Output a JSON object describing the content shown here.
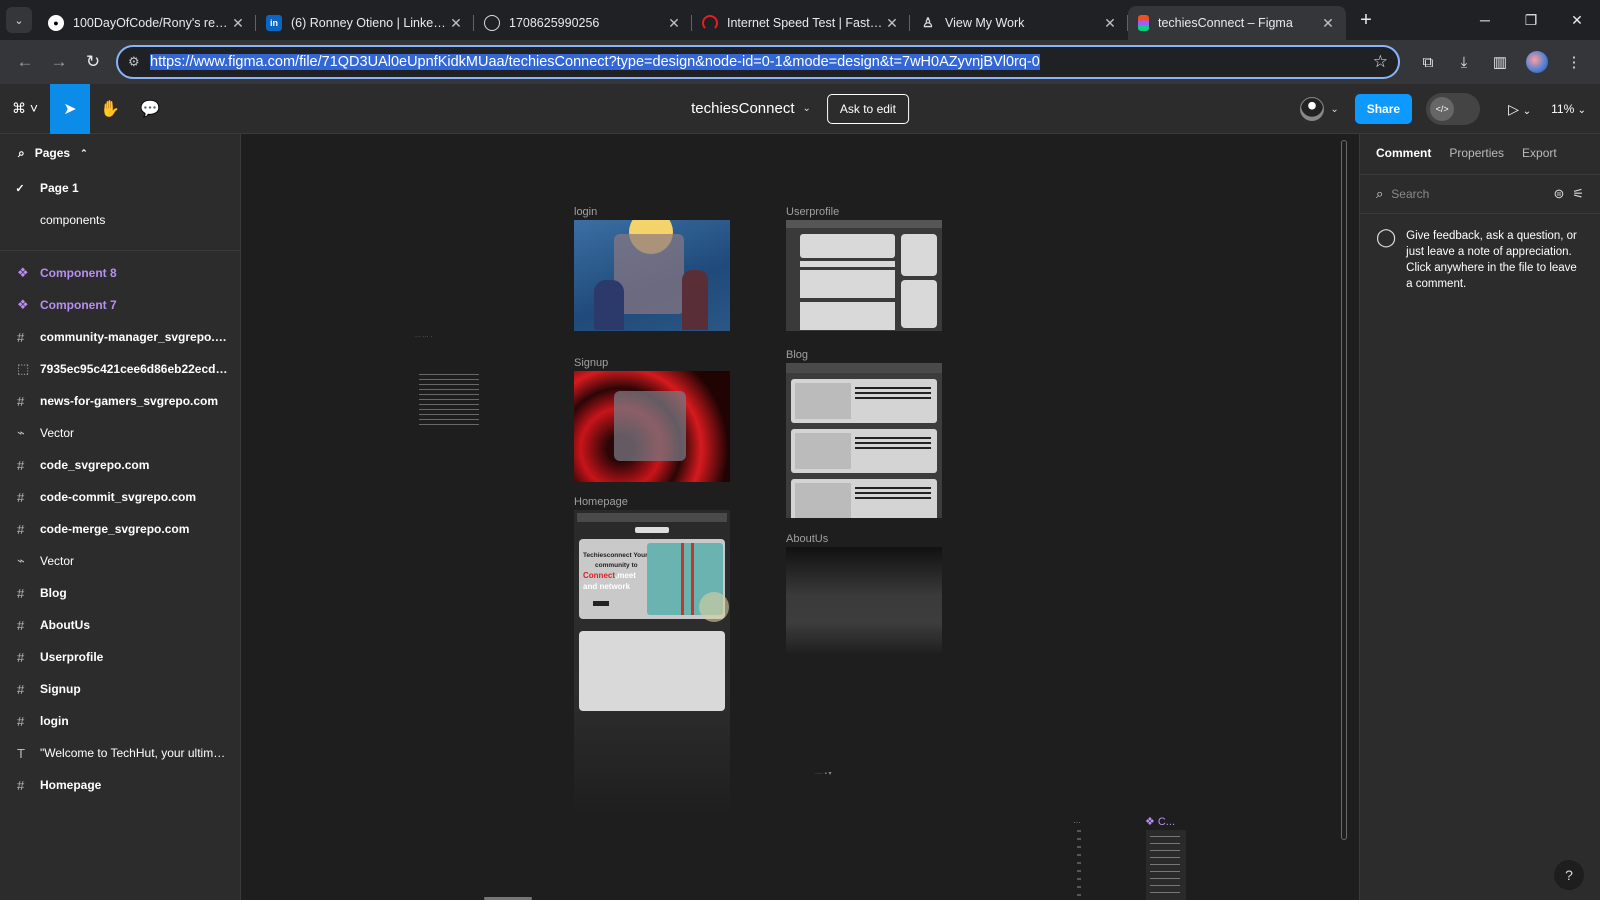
{
  "browser": {
    "tabs": [
      {
        "title": "100DayOfCode/Rony's restau",
        "favicon": "github-icon",
        "active": false
      },
      {
        "title": "(6) Ronney Otieno | LinkedIn",
        "favicon": "linkedin-icon",
        "active": false
      },
      {
        "title": "1708625990256",
        "favicon": "globe-icon",
        "active": false
      },
      {
        "title": "Internet Speed Test | Fast.com",
        "favicon": "fast-icon",
        "active": false
      },
      {
        "title": "View My Work",
        "favicon": "person-icon",
        "active": false
      },
      {
        "title": "techiesConnect – Figma",
        "favicon": "figma-icon",
        "active": true
      }
    ],
    "url": "https://www.figma.com/file/71QD3UAl0eUpnfKidkMUaa/techiesConnect?type=design&node-id=0-1&mode=design&t=7wH0AZyvnjBVl0rq-0"
  },
  "figma": {
    "file_name": "techiesConnect",
    "ask_to_edit": "Ask to edit",
    "share": "Share",
    "zoom": "11%",
    "pages_label": "Pages",
    "pages": [
      {
        "name": "Page 1",
        "current": true
      },
      {
        "name": "components",
        "current": false
      }
    ],
    "layers": [
      {
        "name": "Component 8",
        "icon": "component-icon",
        "kind": "comp"
      },
      {
        "name": "Component 7",
        "icon": "component-icon",
        "kind": "comp"
      },
      {
        "name": "community-manager_svgrepo.com",
        "icon": "frame-icon",
        "kind": "frame"
      },
      {
        "name": "7935ec95c421cee6d86eb22ecd1...",
        "icon": "image-icon",
        "kind": "frame"
      },
      {
        "name": "news-for-gamers_svgrepo.com",
        "icon": "frame-icon",
        "kind": "frame"
      },
      {
        "name": "Vector",
        "icon": "vector-icon",
        "kind": "plain"
      },
      {
        "name": "code_svgrepo.com",
        "icon": "frame-icon",
        "kind": "frame"
      },
      {
        "name": "code-commit_svgrepo.com",
        "icon": "frame-icon",
        "kind": "frame"
      },
      {
        "name": "code-merge_svgrepo.com",
        "icon": "frame-icon",
        "kind": "frame"
      },
      {
        "name": "Vector",
        "icon": "vector-icon",
        "kind": "plain"
      },
      {
        "name": "Blog",
        "icon": "frame-icon",
        "kind": "frame"
      },
      {
        "name": "AboutUs",
        "icon": "frame-icon",
        "kind": "frame"
      },
      {
        "name": "Userprofile",
        "icon": "frame-icon",
        "kind": "frame"
      },
      {
        "name": "Signup",
        "icon": "frame-icon",
        "kind": "frame"
      },
      {
        "name": "login",
        "icon": "frame-icon",
        "kind": "frame"
      },
      {
        "name": "\"Welcome to TechHut, your ultimat...",
        "icon": "text-icon",
        "kind": "plain"
      },
      {
        "name": "Homepage",
        "icon": "frame-icon",
        "kind": "frame"
      }
    ],
    "canvas": {
      "frames": {
        "login": "login",
        "signup": "Signup",
        "homepage": "Homepage",
        "userprofile": "Userprofile",
        "blog": "Blog",
        "aboutus": "AboutUs",
        "component": "C..."
      },
      "homepage_hero": {
        "line1": "Techiesconnect Your",
        "line2": "community to",
        "line3a": "Connect",
        "line3b": ",meet",
        "line4": "and network"
      }
    },
    "right_panel": {
      "tabs": [
        "Comment",
        "Properties",
        "Export"
      ],
      "search_placeholder": "Search",
      "comment_hint": "Give feedback, ask a question, or just leave a note of appreciation. Click anywhere in the file to leave a comment."
    }
  },
  "colors": {
    "accent": "#0d99ff",
    "component": "#b98ef4"
  }
}
